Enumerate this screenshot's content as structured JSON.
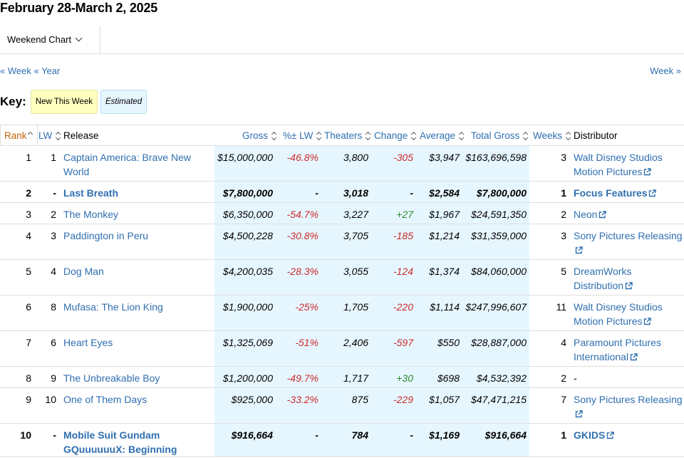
{
  "title": "February 28-March 2, 2025",
  "chart_select": {
    "label": "Weekend Chart"
  },
  "nav": {
    "prev_week": "« Week",
    "prev_year": "« Year",
    "next_week": "Week »"
  },
  "key": {
    "label": "Key:",
    "new": "New This Week",
    "estimated": "Estimated"
  },
  "columns": {
    "rank": "Rank",
    "lw": "LW",
    "release": "Release",
    "gross": "Gross",
    "pct": "%± LW",
    "theaters": "Theaters",
    "change": "Change",
    "average": "Average",
    "total": "Total Gross",
    "weeks": "Weeks",
    "distributor": "Distributor"
  },
  "rows": [
    {
      "rank": "1",
      "lw": "1",
      "release": "Captain America: Brave New World",
      "gross": "$15,000,000",
      "pct": "-46.8%",
      "theaters": "3,800",
      "change": "-305",
      "average": "$3,947",
      "total": "$163,696,598",
      "weeks": "3",
      "distributor": "Walt Disney Studios Motion Pictures",
      "new": false
    },
    {
      "rank": "2",
      "lw": "-",
      "release": "Last Breath",
      "gross": "$7,800,000",
      "pct": "-",
      "theaters": "3,018",
      "change": "-",
      "average": "$2,584",
      "total": "$7,800,000",
      "weeks": "1",
      "distributor": "Focus Features",
      "new": true
    },
    {
      "rank": "3",
      "lw": "2",
      "release": "The Monkey",
      "gross": "$6,350,000",
      "pct": "-54.7%",
      "theaters": "3,227",
      "change": "+27",
      "average": "$1,967",
      "total": "$24,591,350",
      "weeks": "2",
      "distributor": "Neon",
      "new": false
    },
    {
      "rank": "4",
      "lw": "3",
      "release": "Paddington in Peru",
      "gross": "$4,500,228",
      "pct": "-30.8%",
      "theaters": "3,705",
      "change": "-185",
      "average": "$1,214",
      "total": "$31,359,000",
      "weeks": "3",
      "distributor": "Sony Pictures Releasing",
      "new": false
    },
    {
      "rank": "5",
      "lw": "4",
      "release": "Dog Man",
      "gross": "$4,200,035",
      "pct": "-28.3%",
      "theaters": "3,055",
      "change": "-124",
      "average": "$1,374",
      "total": "$84,060,000",
      "weeks": "5",
      "distributor": "DreamWorks Distribution",
      "new": false
    },
    {
      "rank": "6",
      "lw": "8",
      "release": "Mufasa: The Lion King",
      "gross": "$1,900,000",
      "pct": "-25%",
      "theaters": "1,705",
      "change": "-220",
      "average": "$1,114",
      "total": "$247,996,607",
      "weeks": "11",
      "distributor": "Walt Disney Studios Motion Pictures",
      "new": false
    },
    {
      "rank": "7",
      "lw": "6",
      "release": "Heart Eyes",
      "gross": "$1,325,069",
      "pct": "-51%",
      "theaters": "2,406",
      "change": "-597",
      "average": "$550",
      "total": "$28,887,000",
      "weeks": "4",
      "distributor": "Paramount Pictures International",
      "new": false
    },
    {
      "rank": "8",
      "lw": "9",
      "release": "The Unbreakable Boy",
      "gross": "$1,200,000",
      "pct": "-49.7%",
      "theaters": "1,717",
      "change": "+30",
      "average": "$698",
      "total": "$4,532,392",
      "weeks": "2",
      "distributor": "-",
      "new": false
    },
    {
      "rank": "9",
      "lw": "10",
      "release": "One of Them Days",
      "gross": "$925,000",
      "pct": "-33.2%",
      "theaters": "875",
      "change": "-229",
      "average": "$1,057",
      "total": "$47,471,215",
      "weeks": "7",
      "distributor": "Sony Pictures Releasing",
      "new": false
    },
    {
      "rank": "10",
      "lw": "-",
      "release": "Mobile Suit Gundam GQuuuuuuX: Beginning",
      "gross": "$916,664",
      "pct": "-",
      "theaters": "784",
      "change": "-",
      "average": "$1,169",
      "total": "$916,664",
      "weeks": "1",
      "distributor": "GKIDS",
      "new": true
    }
  ],
  "colors": {
    "link": "#2f6fb0",
    "active_sort": "#c0620a",
    "estimated_bg": "#e6f6ff",
    "new_bg": "#ffffbf",
    "negative": "#cc2b2b",
    "positive": "#2c8a2c"
  },
  "icons": {
    "sort": "sort-arrows-icon",
    "external": "external-link-icon",
    "dropdown": "chevron-down-icon"
  }
}
